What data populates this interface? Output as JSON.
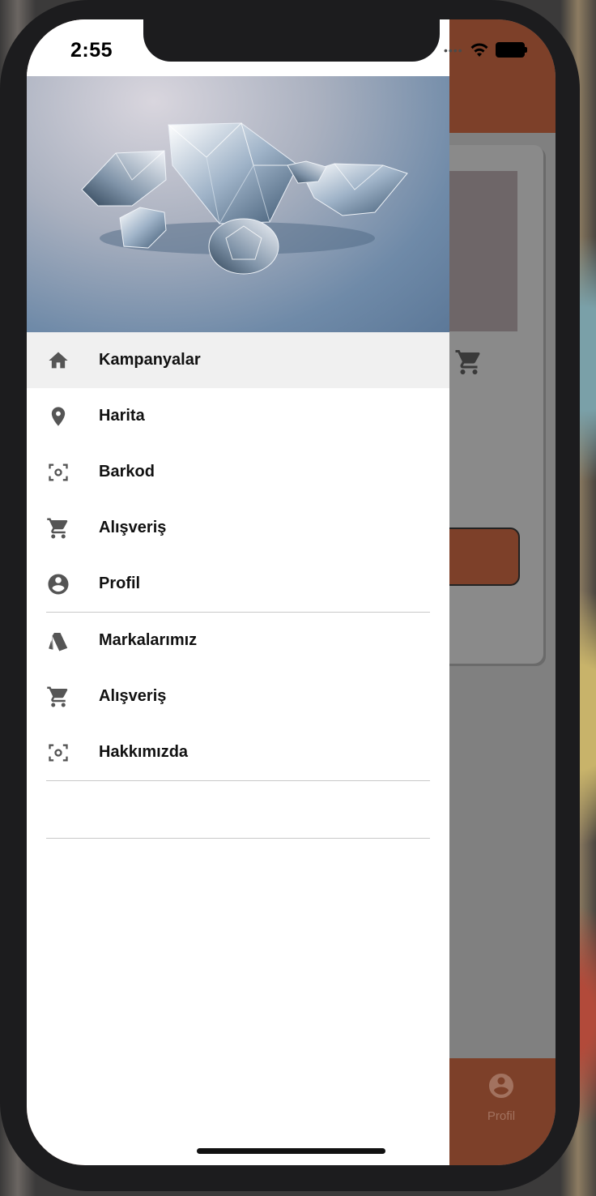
{
  "status_bar": {
    "time": "2:55"
  },
  "drawer": {
    "header_image_alt": "diamonds",
    "menu_primary": [
      {
        "label": "Kampanyalar",
        "icon": "home-icon",
        "active": true
      },
      {
        "label": "Harita",
        "icon": "location-pin-icon",
        "active": false
      },
      {
        "label": "Barkod",
        "icon": "scan-icon",
        "active": false
      },
      {
        "label": "Alışveriş",
        "icon": "cart-icon",
        "active": false
      },
      {
        "label": "Profil",
        "icon": "account-circle-icon",
        "active": false
      }
    ],
    "menu_secondary": [
      {
        "label": "Markalarımız",
        "icon": "cards-icon"
      },
      {
        "label": "Alışveriş",
        "icon": "cart-icon"
      },
      {
        "label": "Hakkımızda",
        "icon": "scan-icon"
      }
    ]
  },
  "background_app": {
    "tab_profile_label": "Profil"
  },
  "colors": {
    "brand": "#7d4029",
    "icon_gray": "#555555",
    "active_bg": "#f0f0f0"
  }
}
